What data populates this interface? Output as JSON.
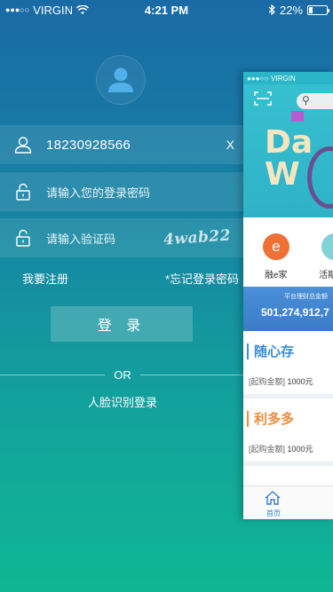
{
  "status_bar": {
    "carrier": "VIRGIN",
    "time": "4:21 PM",
    "battery": "22%",
    "battery_level": 0.22
  },
  "login": {
    "phone_value": "18230928566",
    "clear_label": "X",
    "password_placeholder": "请输入您的登录密码",
    "captcha_placeholder": "请输入验证码",
    "captcha_text": "4wab22",
    "register_link": "我要注册",
    "forgot_link": "*忘记登录密码",
    "login_button": "登 录",
    "or_label": "OR",
    "face_login": "人脸识别登录"
  },
  "preview": {
    "carrier": "VIRGIN",
    "banner_text": "Da\nW",
    "icon1_letter": "e",
    "icon1_label": "融e家",
    "icon2_label": "活期",
    "platform_caption": "平台理财总金额",
    "platform_amount": "501,274,912,7",
    "products": [
      {
        "name": "随心存",
        "min_label": "[起购金额]",
        "min_value": "1000元",
        "color": "#3a8fd1"
      },
      {
        "name": "利多多",
        "min_label": "[起购金额]",
        "min_value": "1000元",
        "color": "#ef8c3a"
      }
    ],
    "tab_home": "首页"
  }
}
